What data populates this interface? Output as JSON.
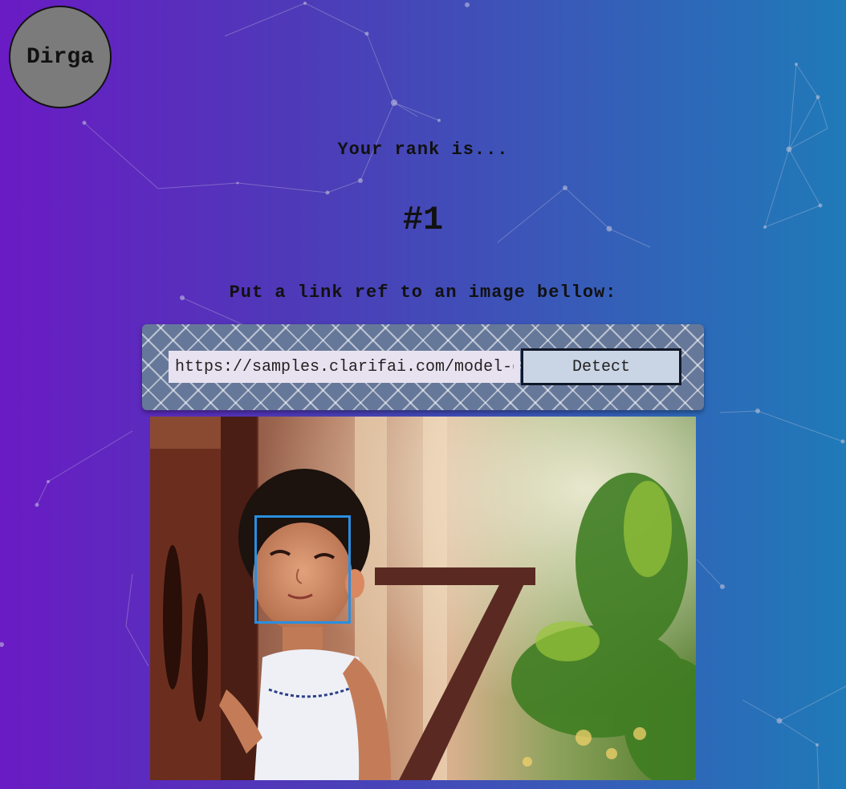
{
  "brand": {
    "logo_text": "Dirga"
  },
  "rank": {
    "label": "Your rank is...",
    "value": "#1"
  },
  "form": {
    "instruction": "Put a link ref to an image bellow:",
    "url_value": "https://samples.clarifai.com/model-g",
    "detect_label": "Detect"
  },
  "colors": {
    "gradient_start": "#6a1bc4",
    "gradient_end": "#1f7ab8",
    "face_box": "#2a8fe0",
    "logo_fill": "#7b7b7b",
    "button_fill": "#c9d4e4"
  },
  "image": {
    "icon": "photo-icon",
    "description_visible": false
  },
  "detection": {
    "faces_detected": 1
  }
}
